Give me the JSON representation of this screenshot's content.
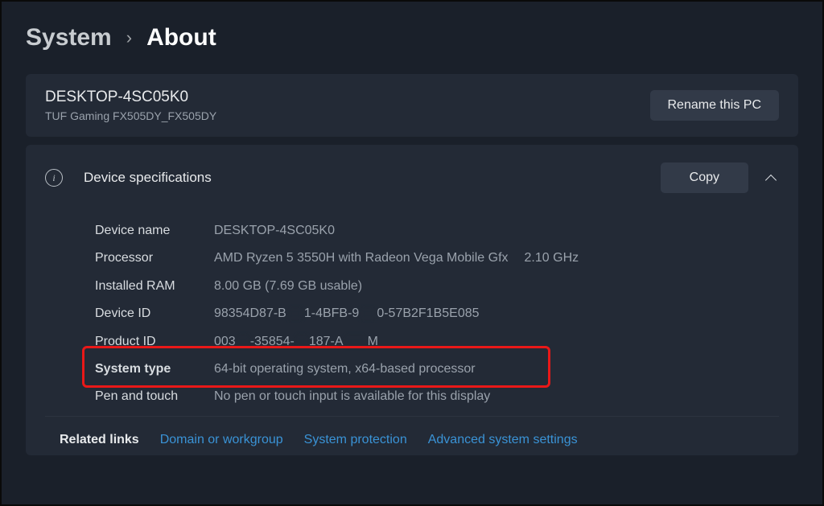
{
  "breadcrumb": {
    "parent": "System",
    "chevron": "›",
    "current": "About"
  },
  "pc": {
    "name": "DESKTOP-4SC05K0",
    "model": "TUF Gaming FX505DY_FX505DY",
    "rename_label": "Rename this PC"
  },
  "specs": {
    "title": "Device specifications",
    "copy_label": "Copy",
    "rows": {
      "device_name": {
        "label": "Device name",
        "value": "DESKTOP-4SC05K0"
      },
      "processor": {
        "label": "Processor",
        "value": "AMD Ryzen 5 3550H with Radeon Vega Mobile Gfx",
        "value_extra": "2.10 GHz"
      },
      "ram": {
        "label": "Installed RAM",
        "value": "8.00 GB (7.69 GB usable)"
      },
      "device_id": {
        "label": "Device ID",
        "p1": "98354D87-B",
        "p2": "1-4BFB-9",
        "p3": "0-57B2F1B5E085"
      },
      "product_id": {
        "label": "Product ID",
        "p1": "003",
        "p2": "-35854-",
        "p3": "187-A",
        "p4": "M"
      },
      "system_type": {
        "label": "System type",
        "value": "64-bit operating system, x64-based processor"
      },
      "pen_touch": {
        "label": "Pen and touch",
        "value": "No pen or touch input is available for this display"
      }
    }
  },
  "related": {
    "label": "Related links",
    "links": {
      "domain": "Domain or workgroup",
      "protection": "System protection",
      "advanced": "Advanced system settings"
    }
  }
}
